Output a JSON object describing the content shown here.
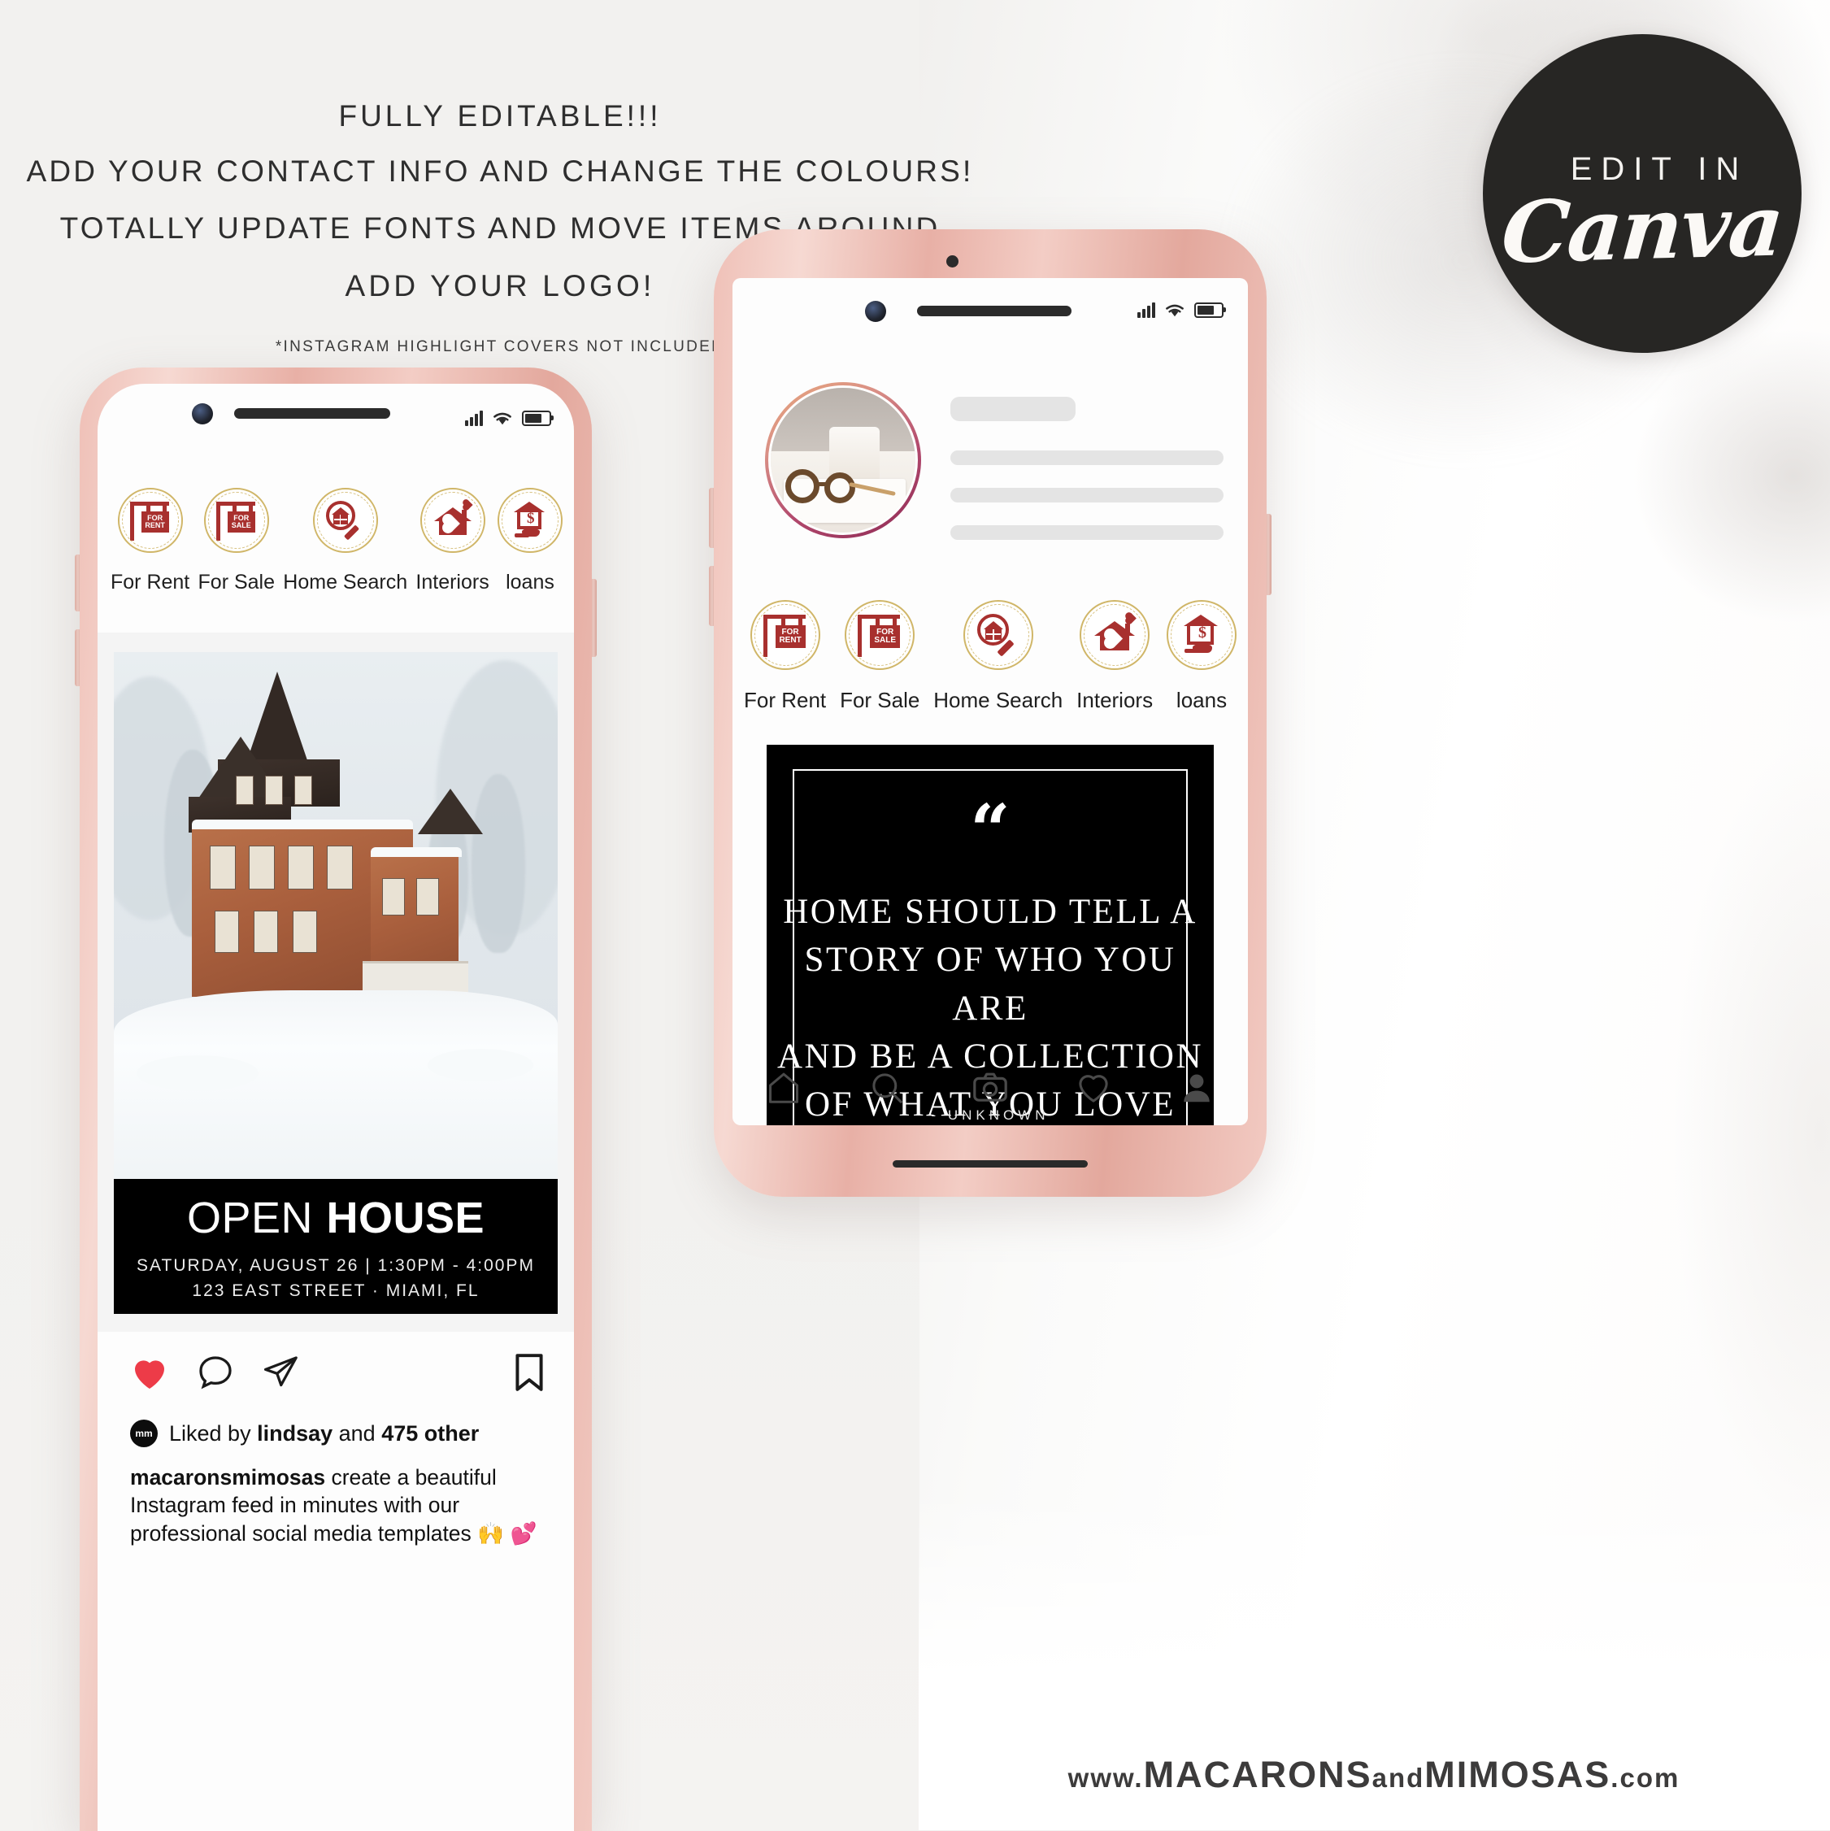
{
  "headline": {
    "line1": "FULLY EDITABLE!!!",
    "line2": "ADD YOUR CONTACT INFO AND CHANGE THE COLOURS!",
    "line3": "TOTALLY UPDATE FONTS AND MOVE ITEMS AROUND",
    "line4": "ADD YOUR LOGO!",
    "note": "*INSTAGRAM HIGHLIGHT COVERS NOT INCLUDED"
  },
  "canva_badge": {
    "top_label": "EDIT IN",
    "brand": "Canva",
    "bg_color": "#272624",
    "text_color": "#fbf9f6"
  },
  "theme": {
    "page_bg": "#f1f0ee",
    "phone_bezel": "#e8b0a6",
    "icon_red": "#a8302e",
    "icon_gold": "#c8a94e",
    "accent_dark": "#000000"
  },
  "highlights": [
    {
      "label": "For Rent",
      "icon": "for-rent-sign-icon",
      "sign_line1": "FOR",
      "sign_line2": "RENT"
    },
    {
      "label": "For Sale",
      "icon": "for-sale-sign-icon",
      "sign_line1": "FOR",
      "sign_line2": "SALE"
    },
    {
      "label": "Home Search",
      "icon": "house-magnifier-icon"
    },
    {
      "label": "Interiors",
      "icon": "house-heart-icon"
    },
    {
      "label": "loans",
      "icon": "house-dollar-hand-icon"
    }
  ],
  "left_phone": {
    "status_bar": {
      "signal": "signal-bars-icon",
      "wifi": "wifi-icon",
      "battery": "battery-icon"
    },
    "post": {
      "photo_alt": "snowy-victorian-house-photo",
      "banner": {
        "title_light": "OPEN",
        "title_bold": "HOUSE",
        "line1": "SATURDAY, AUGUST 26  |  1:30PM - 4:00PM",
        "line2": "123 EAST STREET · MIAMI, FL"
      },
      "actions": {
        "like": "heart-filled-icon",
        "comment": "comment-bubble-icon",
        "share": "paper-plane-icon",
        "save": "bookmark-icon"
      },
      "likes": {
        "avatar_initials": "mm",
        "prefix": "Liked by ",
        "username": "lindsay",
        "middle": " and ",
        "count": "475 other"
      },
      "caption_user": "macaronsmimosas",
      "caption_text": " create a beautiful Instagram feed in minutes with our professional social media templates 🙌 💕"
    }
  },
  "right_phone": {
    "status_bar": {
      "signal": "signal-bars-icon",
      "wifi": "wifi-icon",
      "battery": "battery-icon"
    },
    "profile": {
      "avatar_alt": "glasses-coffee-notebook-avatar"
    },
    "quote_card": {
      "quote_mark": "“",
      "lines": [
        "HOME SHOULD TELL A",
        "STORY OF WHO YOU ARE",
        "AND BE A COLLECTION",
        "OF WHAT YOU LOVE"
      ],
      "author": "- UNKNOWN"
    },
    "navbar": [
      {
        "name": "home-icon"
      },
      {
        "name": "search-icon"
      },
      {
        "name": "camera-icon"
      },
      {
        "name": "heart-icon"
      },
      {
        "name": "profile-icon"
      }
    ]
  },
  "footer": {
    "url_part1": "www.",
    "url_part2": "MACARONS",
    "url_part3": "and",
    "url_part4": "MIMOSAS",
    "url_part5": ".com"
  }
}
